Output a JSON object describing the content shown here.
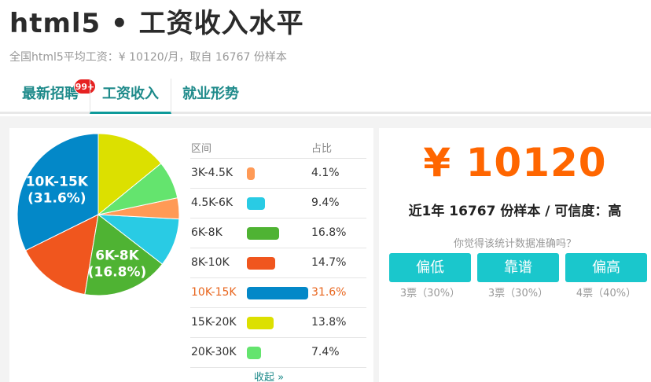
{
  "header": {
    "title": "html5 • 工资收入水平",
    "subtitle": "全国html5平均工资：¥ 10120/月，取自 16767 份样本"
  },
  "tabs": [
    {
      "label": "最新招聘",
      "badge": "99+"
    },
    {
      "label": "工资收入"
    },
    {
      "label": "就业形势"
    }
  ],
  "table": {
    "col_range": "区间",
    "col_pct": "占比",
    "collapse_label": "收起 »"
  },
  "summary": {
    "salary": "¥ 10120",
    "sample_line": "近1年 16767 份样本 / 可信度：高",
    "question": "你觉得该统计数据准确吗？"
  },
  "votes": [
    {
      "label": "偏低",
      "count": "3票（30%）"
    },
    {
      "label": "靠谱",
      "count": "3票（30%）"
    },
    {
      "label": "偏高",
      "count": "4票（40%）"
    }
  ],
  "colors": {
    "accent": "#1e8a8a",
    "salary": "#ff6600",
    "button": "#1ac7cc"
  },
  "chart_data": {
    "type": "pie",
    "categories": [
      "3K-4.5K",
      "4.5K-6K",
      "6K-8K",
      "8K-10K",
      "10K-15K",
      "15K-20K",
      "20K-30K"
    ],
    "values": [
      4.1,
      9.4,
      16.8,
      14.7,
      31.6,
      13.8,
      7.4
    ],
    "pct_labels": [
      "4.1%",
      "9.4%",
      "16.8%",
      "14.7%",
      "31.6%",
      "13.8%",
      "7.4%"
    ],
    "colors": [
      "#ff9a56",
      "#29cbe4",
      "#4fb333",
      "#f0561e",
      "#0388c8",
      "#dce000",
      "#64e46e"
    ],
    "highlight": "10K-15K",
    "slice_labels": [
      {
        "category": "10K-15K",
        "line1": "10K-15K",
        "line2": "(31.6%)"
      },
      {
        "category": "6K-8K",
        "line1": "6K-8K",
        "line2": "(16.8%)"
      }
    ]
  }
}
